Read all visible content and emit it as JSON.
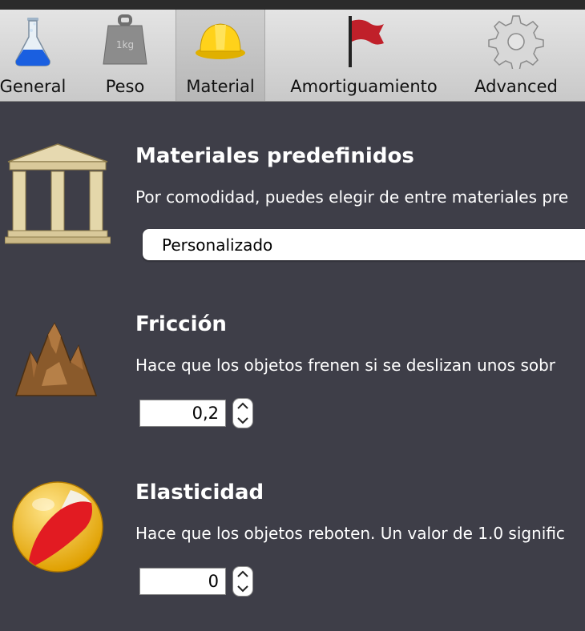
{
  "toolbar": {
    "tabs": [
      {
        "label": "General",
        "icon": "flask-icon"
      },
      {
        "label": "Peso",
        "icon": "weight-icon",
        "icon_text": "1kg"
      },
      {
        "label": "Material",
        "icon": "hardhat-icon",
        "selected": true
      },
      {
        "label": "Amortiguamiento",
        "icon": "flag-icon"
      },
      {
        "label": "Advanced",
        "icon": "gear-icon"
      }
    ]
  },
  "materials": {
    "title": "Materiales predefinidos",
    "description": "Por comodidad, puedes elegir de entre materiales pre",
    "selected": "Personalizado",
    "icon": "temple-icon"
  },
  "friction": {
    "title": "Fricción",
    "description": "Hace que los objetos frenen si se deslizan unos sobr",
    "value": "0,2",
    "icon": "mountain-icon"
  },
  "elasticity": {
    "title": "Elasticidad",
    "description": "Hace que los objetos reboten. Un valor de 1.0 signific",
    "value": "0",
    "icon": "beachball-icon"
  },
  "colors": {
    "background": "#3e3e48",
    "toolbar": "#d6d6d6"
  }
}
